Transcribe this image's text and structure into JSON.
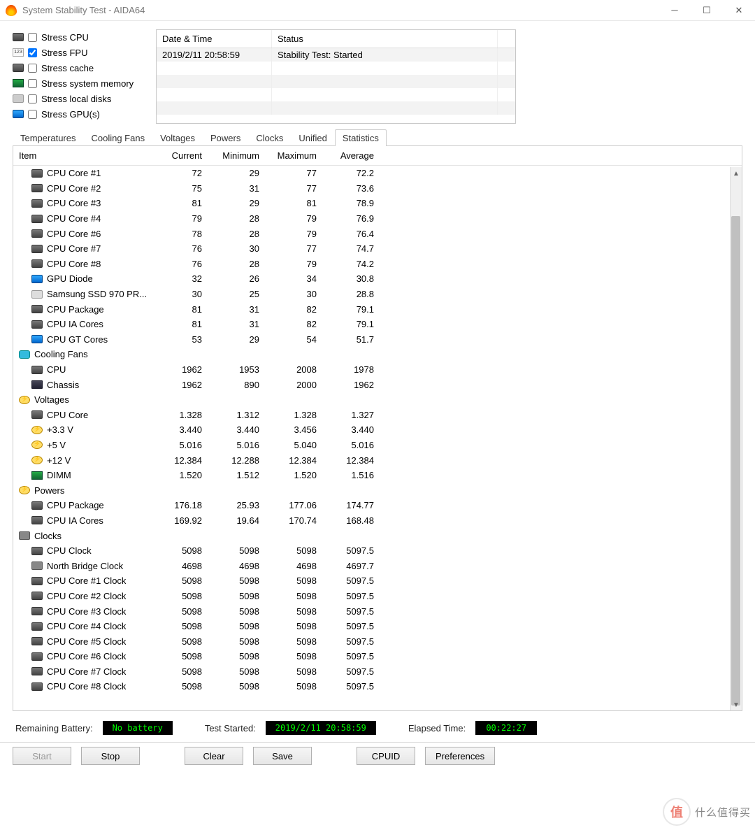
{
  "window": {
    "title": "System Stability Test - AIDA64"
  },
  "stress": [
    {
      "label": "Stress CPU",
      "checked": false,
      "icon": "chip"
    },
    {
      "label": "Stress FPU",
      "checked": true,
      "icon": "123"
    },
    {
      "label": "Stress cache",
      "checked": false,
      "icon": "chip"
    },
    {
      "label": "Stress system memory",
      "checked": false,
      "icon": "ram"
    },
    {
      "label": "Stress local disks",
      "checked": false,
      "icon": "disk"
    },
    {
      "label": "Stress GPU(s)",
      "checked": false,
      "icon": "gpu"
    }
  ],
  "log": {
    "headers": {
      "date": "Date & Time",
      "status": "Status"
    },
    "rows": [
      {
        "date": "2019/2/11 20:58:59",
        "status": "Stability Test: Started"
      }
    ]
  },
  "tabs": [
    "Temperatures",
    "Cooling Fans",
    "Voltages",
    "Powers",
    "Clocks",
    "Unified",
    "Statistics"
  ],
  "active_tab": "Statistics",
  "grid": {
    "headers": {
      "item": "Item",
      "current": "Current",
      "min": "Minimum",
      "max": "Maximum",
      "avg": "Average"
    },
    "rows": [
      {
        "indent": true,
        "icon": "chip",
        "item": "CPU Core #1",
        "c": "72",
        "mn": "29",
        "mx": "77",
        "av": "72.2"
      },
      {
        "indent": true,
        "icon": "chip",
        "item": "CPU Core #2",
        "c": "75",
        "mn": "31",
        "mx": "77",
        "av": "73.6"
      },
      {
        "indent": true,
        "icon": "chip",
        "item": "CPU Core #3",
        "c": "81",
        "mn": "29",
        "mx": "81",
        "av": "78.9"
      },
      {
        "indent": true,
        "icon": "chip",
        "item": "CPU Core #4",
        "c": "79",
        "mn": "28",
        "mx": "79",
        "av": "76.9"
      },
      {
        "indent": true,
        "icon": "chip",
        "item": "CPU Core #6",
        "c": "78",
        "mn": "28",
        "mx": "79",
        "av": "76.4"
      },
      {
        "indent": true,
        "icon": "chip",
        "item": "CPU Core #7",
        "c": "76",
        "mn": "30",
        "mx": "77",
        "av": "74.7"
      },
      {
        "indent": true,
        "icon": "chip",
        "item": "CPU Core #8",
        "c": "76",
        "mn": "28",
        "mx": "79",
        "av": "74.2"
      },
      {
        "indent": true,
        "icon": "gpu",
        "item": "GPU Diode",
        "c": "32",
        "mn": "26",
        "mx": "34",
        "av": "30.8"
      },
      {
        "indent": true,
        "icon": "ssd",
        "item": "Samsung SSD 970 PR...",
        "c": "30",
        "mn": "25",
        "mx": "30",
        "av": "28.8"
      },
      {
        "indent": true,
        "icon": "chip",
        "item": "CPU Package",
        "c": "81",
        "mn": "31",
        "mx": "82",
        "av": "79.1"
      },
      {
        "indent": true,
        "icon": "chip",
        "item": "CPU IA Cores",
        "c": "81",
        "mn": "31",
        "mx": "82",
        "av": "79.1"
      },
      {
        "indent": true,
        "icon": "gpu",
        "item": "CPU GT Cores",
        "c": "53",
        "mn": "29",
        "mx": "54",
        "av": "51.7"
      },
      {
        "indent": false,
        "icon": "fan",
        "item": "Cooling Fans",
        "c": "",
        "mn": "",
        "mx": "",
        "av": ""
      },
      {
        "indent": true,
        "icon": "chip",
        "item": "CPU",
        "c": "1962",
        "mn": "1953",
        "mx": "2008",
        "av": "1978"
      },
      {
        "indent": true,
        "icon": "case",
        "item": "Chassis",
        "c": "1962",
        "mn": "890",
        "mx": "2000",
        "av": "1962"
      },
      {
        "indent": false,
        "icon": "bolt",
        "item": "Voltages",
        "c": "",
        "mn": "",
        "mx": "",
        "av": ""
      },
      {
        "indent": true,
        "icon": "chip",
        "item": "CPU Core",
        "c": "1.328",
        "mn": "1.312",
        "mx": "1.328",
        "av": "1.327"
      },
      {
        "indent": true,
        "icon": "bolt",
        "item": "+3.3 V",
        "c": "3.440",
        "mn": "3.440",
        "mx": "3.456",
        "av": "3.440"
      },
      {
        "indent": true,
        "icon": "bolt",
        "item": "+5 V",
        "c": "5.016",
        "mn": "5.016",
        "mx": "5.040",
        "av": "5.016"
      },
      {
        "indent": true,
        "icon": "bolt",
        "item": "+12 V",
        "c": "12.384",
        "mn": "12.288",
        "mx": "12.384",
        "av": "12.384"
      },
      {
        "indent": true,
        "icon": "ram",
        "item": "DIMM",
        "c": "1.520",
        "mn": "1.512",
        "mx": "1.520",
        "av": "1.516"
      },
      {
        "indent": false,
        "icon": "bolt",
        "item": "Powers",
        "c": "",
        "mn": "",
        "mx": "",
        "av": ""
      },
      {
        "indent": true,
        "icon": "chip",
        "item": "CPU Package",
        "c": "176.18",
        "mn": "25.93",
        "mx": "177.06",
        "av": "174.77"
      },
      {
        "indent": true,
        "icon": "chip",
        "item": "CPU IA Cores",
        "c": "169.92",
        "mn": "19.64",
        "mx": "170.74",
        "av": "168.48"
      },
      {
        "indent": false,
        "icon": "clock",
        "item": "Clocks",
        "c": "",
        "mn": "",
        "mx": "",
        "av": ""
      },
      {
        "indent": true,
        "icon": "chip",
        "item": "CPU Clock",
        "c": "5098",
        "mn": "5098",
        "mx": "5098",
        "av": "5097.5"
      },
      {
        "indent": true,
        "icon": "clock",
        "item": "North Bridge Clock",
        "c": "4698",
        "mn": "4698",
        "mx": "4698",
        "av": "4697.7"
      },
      {
        "indent": true,
        "icon": "chip",
        "item": "CPU Core #1 Clock",
        "c": "5098",
        "mn": "5098",
        "mx": "5098",
        "av": "5097.5"
      },
      {
        "indent": true,
        "icon": "chip",
        "item": "CPU Core #2 Clock",
        "c": "5098",
        "mn": "5098",
        "mx": "5098",
        "av": "5097.5"
      },
      {
        "indent": true,
        "icon": "chip",
        "item": "CPU Core #3 Clock",
        "c": "5098",
        "mn": "5098",
        "mx": "5098",
        "av": "5097.5"
      },
      {
        "indent": true,
        "icon": "chip",
        "item": "CPU Core #4 Clock",
        "c": "5098",
        "mn": "5098",
        "mx": "5098",
        "av": "5097.5"
      },
      {
        "indent": true,
        "icon": "chip",
        "item": "CPU Core #5 Clock",
        "c": "5098",
        "mn": "5098",
        "mx": "5098",
        "av": "5097.5"
      },
      {
        "indent": true,
        "icon": "chip",
        "item": "CPU Core #6 Clock",
        "c": "5098",
        "mn": "5098",
        "mx": "5098",
        "av": "5097.5"
      },
      {
        "indent": true,
        "icon": "chip",
        "item": "CPU Core #7 Clock",
        "c": "5098",
        "mn": "5098",
        "mx": "5098",
        "av": "5097.5"
      },
      {
        "indent": true,
        "icon": "chip",
        "item": "CPU Core #8 Clock",
        "c": "5098",
        "mn": "5098",
        "mx": "5098",
        "av": "5097.5"
      }
    ]
  },
  "status": {
    "battery_label": "Remaining Battery:",
    "battery_value": "No battery",
    "started_label": "Test Started:",
    "started_value": "2019/2/11 20:58:59",
    "elapsed_label": "Elapsed Time:",
    "elapsed_value": "00:22:27"
  },
  "buttons": {
    "start": "Start",
    "stop": "Stop",
    "clear": "Clear",
    "save": "Save",
    "cpuid": "CPUID",
    "prefs": "Preferences"
  },
  "watermark": {
    "badge": "值",
    "text": "什么值得买"
  }
}
